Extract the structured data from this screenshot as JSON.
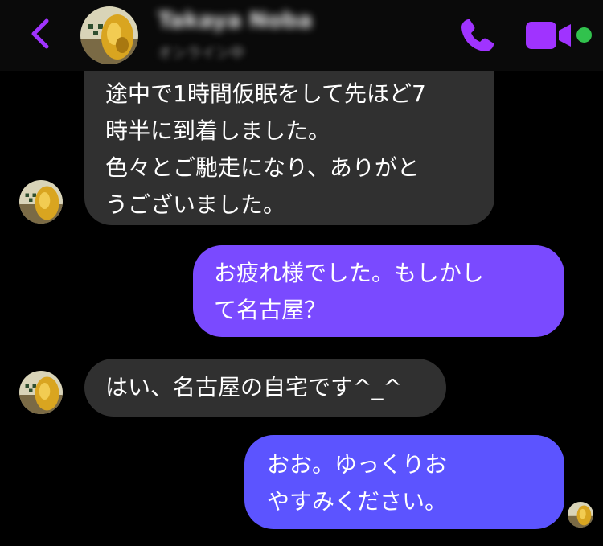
{
  "header": {
    "contact_name": "Takaya Noba",
    "status": "オンライン中",
    "back_icon": "chevron-left-icon",
    "call_icon": "phone-icon",
    "video_icon": "video-camera-icon",
    "online_indicator": "online-dot",
    "accent_color": "#a033ff",
    "online_color": "#31c24d"
  },
  "messages": [
    {
      "direction": "incoming",
      "text": "途中で1時間仮眠をして先ほど7\n時半に到着しました。\n色々とご馳走になり、ありがと\nうございました。"
    },
    {
      "direction": "outgoing",
      "text": "お疲れ様でした。もしかし\nて名古屋？"
    },
    {
      "direction": "incoming",
      "text": "はい、名古屋の自宅です^_^"
    },
    {
      "direction": "outgoing",
      "text": "おお。ゆっくりお\nやすみください。"
    }
  ],
  "colors": {
    "incoming_bubble": "#303030",
    "outgoing_bubble_top": "#7a4aff",
    "outgoing_bubble_bottom": "#5c54ff",
    "background": "#000000"
  }
}
